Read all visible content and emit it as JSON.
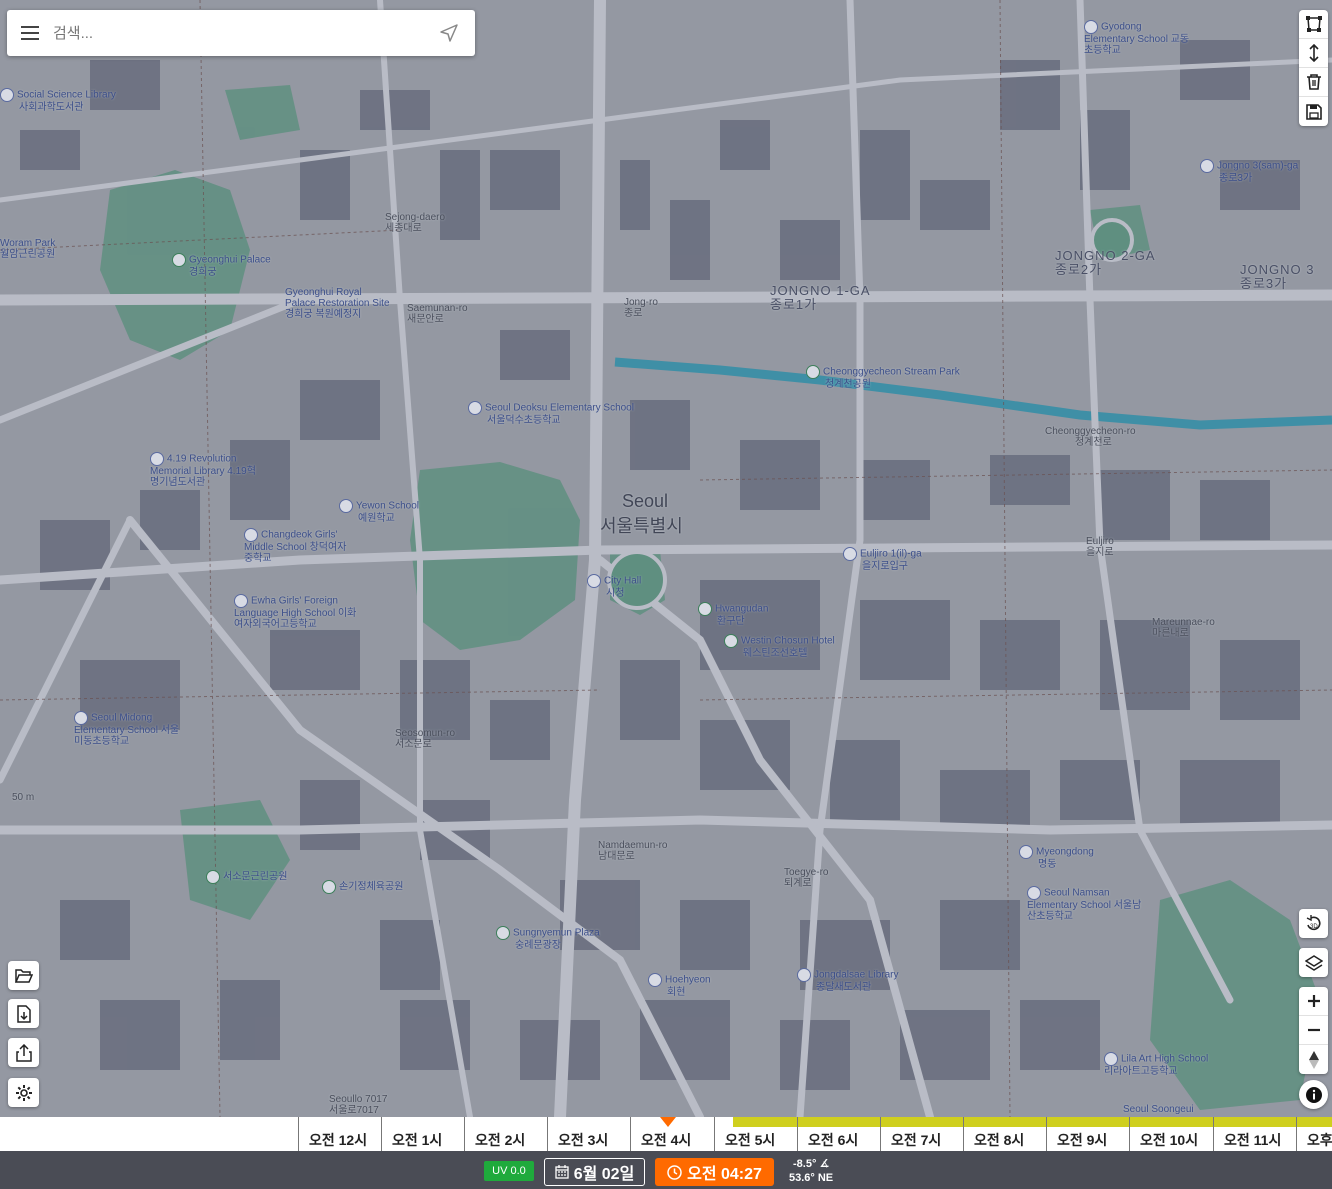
{
  "search": {
    "placeholder": "검색..."
  },
  "map": {
    "city_name_en": "Seoul",
    "city_name_ko": "서울특별시",
    "districts": [
      {
        "text": "JONGNO 1-GA",
        "sub": "종로1가"
      },
      {
        "text": "JONGNO 2-GA",
        "sub": "종로2가"
      },
      {
        "text": "JONGNO 3",
        "sub": "종로3가"
      }
    ],
    "labels": [
      {
        "en": "Gyeonghui Palace",
        "ko": "경희궁"
      },
      {
        "en": "Gyeonghui Royal Palace Restoration Site",
        "ko": "경희궁 복원예정지"
      },
      {
        "en": "Seoul Deoksu Elementary School",
        "ko": "서울덕수초등학교"
      },
      {
        "en": "City Hall",
        "ko": "시청"
      },
      {
        "en": "Hwangudan",
        "ko": "환구단"
      },
      {
        "en": "Westin Chosun Hotel",
        "ko": "웨스틴조선호텔"
      },
      {
        "en": "Euljiro 1(il)-ga",
        "ko": "을지로입구"
      },
      {
        "en": "Cheonggyecheon Stream Park",
        "ko": "청계천공원"
      },
      {
        "en": "Cheonggyecheon-ro",
        "ko": "청계천로"
      },
      {
        "en": "4.19 Revolution Memorial Library",
        "ko": "4.19혁명기념도서관"
      },
      {
        "en": "Yewon School",
        "ko": "예원학교"
      },
      {
        "en": "Changdeok Girls' Middle School",
        "ko": "창덕여자중학교"
      },
      {
        "en": "Ewha Girls' Foreign Language High School",
        "ko": "이화여자외국어고등학교"
      },
      {
        "en": "Seoul Midong Elementary School",
        "ko": "서울미동초등학교"
      },
      {
        "en": "Myeongdong",
        "ko": "명동"
      },
      {
        "en": "Seoul Namsan Elementary School",
        "ko": "서울남산초등학교"
      },
      {
        "en": "Hoehyeon",
        "ko": "회현"
      },
      {
        "en": "Jongdalsae Library",
        "ko": "종달새도서관"
      },
      {
        "en": "Sungnyemun Plaza",
        "ko": "숭례문광장"
      },
      {
        "en": "Jongno 3(sam)-ga",
        "ko": "종로3가"
      },
      {
        "en": "Social Science Library",
        "ko": "사회과학도서관"
      },
      {
        "en": "Gyodong Elementary School",
        "ko": "교동초등학교"
      },
      {
        "en": "Woram Park",
        "ko": "월암근린공원"
      },
      {
        "en": "Lila Art High School",
        "ko": "리라아트고등학교"
      },
      {
        "en": "Seoul Soongeui",
        "ko": ""
      },
      {
        "en": "Euljiro",
        "ko": "을지로"
      },
      {
        "en": "Mareunnae-ro",
        "ko": "마른내로"
      },
      {
        "en": "Sejong-daero",
        "ko": "세종대로"
      },
      {
        "en": "Saemunan-ro",
        "ko": "새문안로"
      },
      {
        "en": "Jong-ro",
        "ko": "종로"
      },
      {
        "en": "Toegye-ro",
        "ko": "퇴계로"
      },
      {
        "en": "Namdaemun-ro",
        "ko": "남대문로"
      },
      {
        "en": "Seosomun-ro",
        "ko": "서소문로"
      },
      {
        "en": "Seoullo 7017",
        "ko": "서울로7017"
      },
      {
        "en": "서소문근린공원",
        "ko": ""
      },
      {
        "en": "손기정체육공원",
        "ko": ""
      },
      {
        "en": "50 m",
        "ko": ""
      }
    ]
  },
  "toolbar_right": {
    "top": [
      "polygon-tool",
      "height-tool",
      "delete-tool",
      "save-tool"
    ],
    "bottom": [
      "rotate",
      "layers",
      "zoom-in",
      "zoom-out",
      "compass",
      "info"
    ]
  },
  "toolbar_left": [
    "open-folder",
    "import-file",
    "share",
    "settings"
  ],
  "timeline": {
    "hours": [
      "오전 12시",
      "오전 1시",
      "오전 2시",
      "오전 3시",
      "오전 4시",
      "오전 5시",
      "오전 6시",
      "오전 7시",
      "오전 8시",
      "오전 9시",
      "오전 10시",
      "오전 11시",
      "오후"
    ],
    "uv": "UV 0.0",
    "date": "6월 02일",
    "time": "오전 04:27",
    "sun_elevation": "-8.5°",
    "sun_azimuth": "53.6° NE"
  },
  "colors": {
    "accent": "#ff6a00",
    "uv_green": "#1faa3c",
    "sun_bar": "#cfcf1e",
    "bar_bg": "#4a4c55"
  }
}
